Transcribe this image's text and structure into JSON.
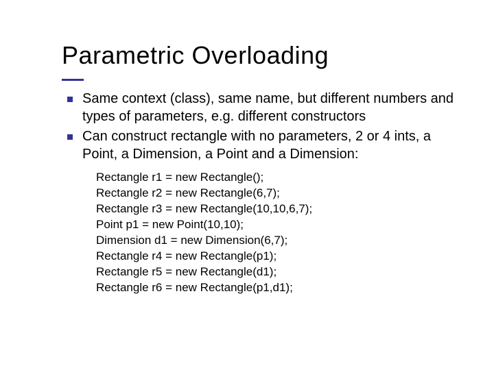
{
  "title": "Parametric Overloading",
  "bullets": [
    "Same context (class), same name, but different numbers and types of parameters, e.g. different constructors",
    "Can construct rectangle with no parameters, 2 or 4 ints, a Point, a Dimension, a Point and a Dimension:"
  ],
  "code": [
    "Rectangle r1 = new Rectangle();",
    "Rectangle r2 = new Rectangle(6,7);",
    "Rectangle r3 = new Rectangle(10,10,6,7);",
    "Point p1 = new Point(10,10);",
    "Dimension d1 = new Dimension(6,7);",
    "Rectangle r4 = new Rectangle(p1);",
    "Rectangle r5 = new Rectangle(d1);",
    "Rectangle r6 = new Rectangle(p1,d1);"
  ]
}
